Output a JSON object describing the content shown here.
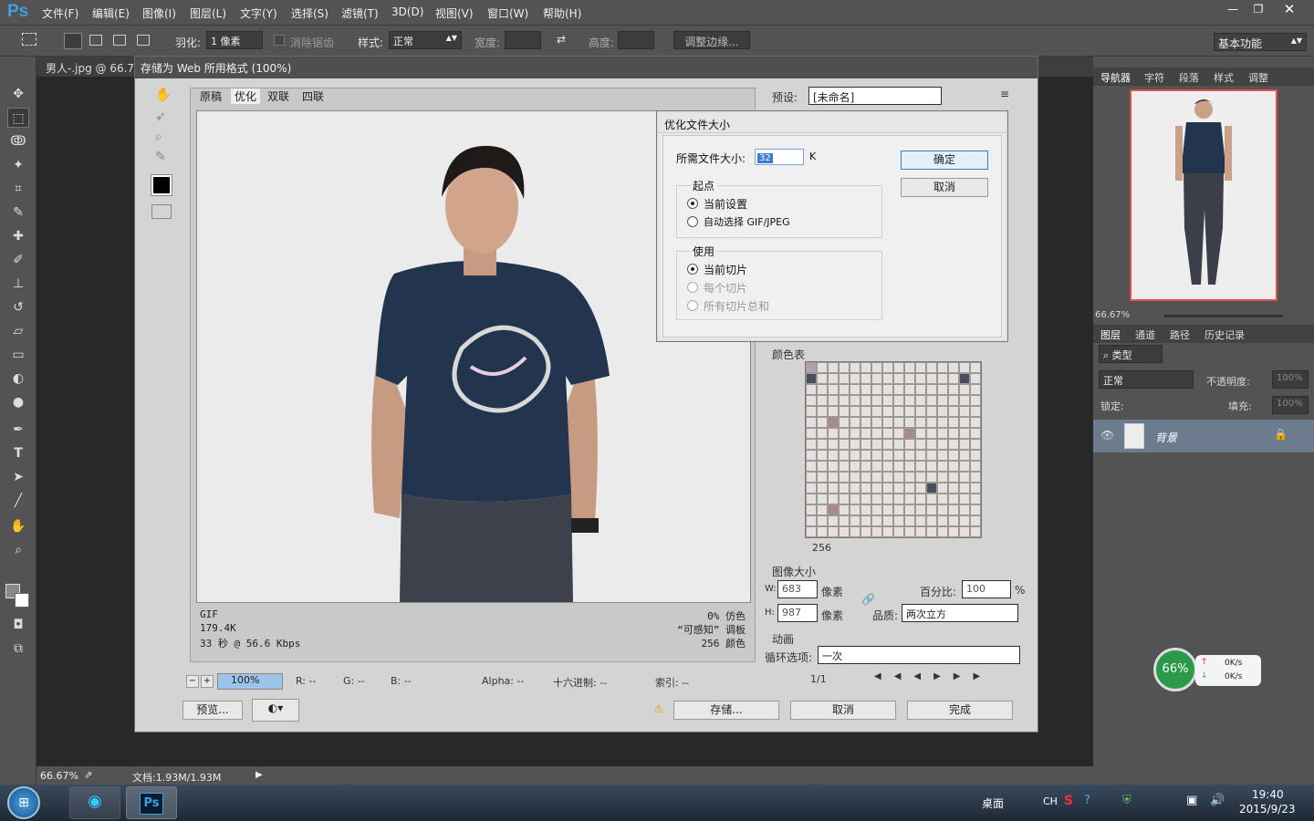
{
  "app": {
    "logo": "Ps"
  },
  "menu": [
    "文件(F)",
    "编辑(E)",
    "图像(I)",
    "图层(L)",
    "文字(Y)",
    "选择(S)",
    "滤镜(T)",
    "3D(D)",
    "视图(V)",
    "窗口(W)",
    "帮助(H)"
  ],
  "options": {
    "feather_label": "羽化:",
    "feather_value": "1 像素",
    "antialias": "消除锯齿",
    "style_label": "样式:",
    "style_value": "正常",
    "width_label": "宽度:",
    "height_label": "高度:",
    "refine": "调整边缘...",
    "workspace": "基本功能"
  },
  "document": {
    "tab": "男人-.jpg @ 66.7",
    "zoom": "66.67%",
    "doc_info": "文档:1.93M/1.93M"
  },
  "dialog": {
    "title": "存储为 Web 所用格式 (100%)",
    "tabs": [
      "原稿",
      "优化",
      "双联",
      "四联"
    ],
    "info_left": [
      "GIF",
      "179.4K",
      "33 秒 @ 56.6 Kbps"
    ],
    "info_right": [
      "0% 仿色",
      "“可感知” 调板",
      "256 颜色"
    ],
    "zoom": "100%",
    "readout": {
      "r": "R: --",
      "g": "G: --",
      "b": "B: --",
      "alpha": "Alpha: --",
      "hex": "十六进制: --",
      "index": "索引: --"
    },
    "preset_label": "预设:",
    "preset_value": "[未命名]",
    "color_table_label": "颜色表",
    "color_count": "256",
    "image_size_label": "图像大小",
    "w_label": "W:",
    "w_value": "683",
    "h_label": "H:",
    "h_value": "987",
    "px": "像素",
    "percent_label": "百分比:",
    "percent_value": "100",
    "percent_unit": "%",
    "quality_label": "品质:",
    "quality_value": "两次立方",
    "anim_label": "动画",
    "loop_label": "循环选项:",
    "loop_value": "一次",
    "frame": "1/1",
    "preview_btn": "预览...",
    "save_btn": "存储...",
    "cancel_btn": "取消",
    "done_btn": "完成"
  },
  "optimize": {
    "title": "优化文件大小",
    "size_label": "所需文件大小:",
    "size_value": "32",
    "size_unit": "K",
    "ok": "确定",
    "cancel": "取消",
    "start_label": "起点",
    "start_opt1": "当前设置",
    "start_opt2": "自动选择 GIF/JPEG",
    "use_label": "使用",
    "use_opt1": "当前切片",
    "use_opt2": "每个切片",
    "use_opt3": "所有切片总和"
  },
  "right_panel": {
    "tabs1": [
      "导航器",
      "字符",
      "段落",
      "样式",
      "调整"
    ],
    "nav_zoom": "66.67%",
    "tabs2": [
      "图层",
      "通道",
      "路径",
      "历史记录"
    ],
    "kind": "类型",
    "blend": "正常",
    "opacity_label": "不透明度:",
    "opacity_value": "100%",
    "lock_label": "锁定:",
    "fill_label": "填充:",
    "fill_value": "100%",
    "layer_name": "背景"
  },
  "widget": {
    "percent": "66%",
    "up": "0K/s",
    "down": "0K/s"
  },
  "taskbar": {
    "desktop": "桌面",
    "lang": "CH",
    "time": "19:40",
    "date": "2015/9/23"
  },
  "colors": {
    "accent": "#3aa0e8",
    "shirt": "#23344f"
  }
}
